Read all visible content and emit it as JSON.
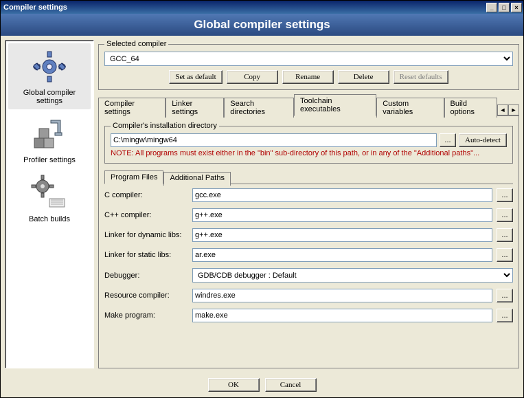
{
  "window": {
    "title": "Compiler settings"
  },
  "header": {
    "title": "Global compiler settings"
  },
  "sidebar": {
    "items": [
      {
        "label": "Global compiler settings"
      },
      {
        "label": "Profiler settings"
      },
      {
        "label": "Batch builds"
      }
    ]
  },
  "selected_compiler": {
    "legend": "Selected compiler",
    "value": "GCC_64",
    "set_default": "Set as default",
    "copy": "Copy",
    "rename": "Rename",
    "delete": "Delete",
    "reset": "Reset defaults"
  },
  "tabs": {
    "items": [
      "Compiler settings",
      "Linker settings",
      "Search directories",
      "Toolchain executables",
      "Custom variables",
      "Build options"
    ],
    "active_index": 3
  },
  "install_dir": {
    "legend": "Compiler's installation directory",
    "value": "C:\\mingw\\mingw64",
    "browse": "...",
    "auto_detect": "Auto-detect",
    "note": "NOTE: All programs must exist either in the \"bin\" sub-directory of this path, or in any of the \"Additional paths\"..."
  },
  "sub_tabs": {
    "items": [
      "Program Files",
      "Additional Paths"
    ],
    "active_index": 0
  },
  "programs": {
    "rows": [
      {
        "label": "C compiler:",
        "value": "gcc.exe",
        "type": "text"
      },
      {
        "label": "C++ compiler:",
        "value": "g++.exe",
        "type": "text"
      },
      {
        "label": "Linker for dynamic libs:",
        "value": "g++.exe",
        "type": "text"
      },
      {
        "label": "Linker for static libs:",
        "value": "ar.exe",
        "type": "text"
      },
      {
        "label": "Debugger:",
        "value": "GDB/CDB debugger : Default",
        "type": "select"
      },
      {
        "label": "Resource compiler:",
        "value": "windres.exe",
        "type": "text"
      },
      {
        "label": "Make program:",
        "value": "make.exe",
        "type": "text"
      }
    ],
    "ellipsis": "..."
  },
  "footer": {
    "ok": "OK",
    "cancel": "Cancel"
  }
}
